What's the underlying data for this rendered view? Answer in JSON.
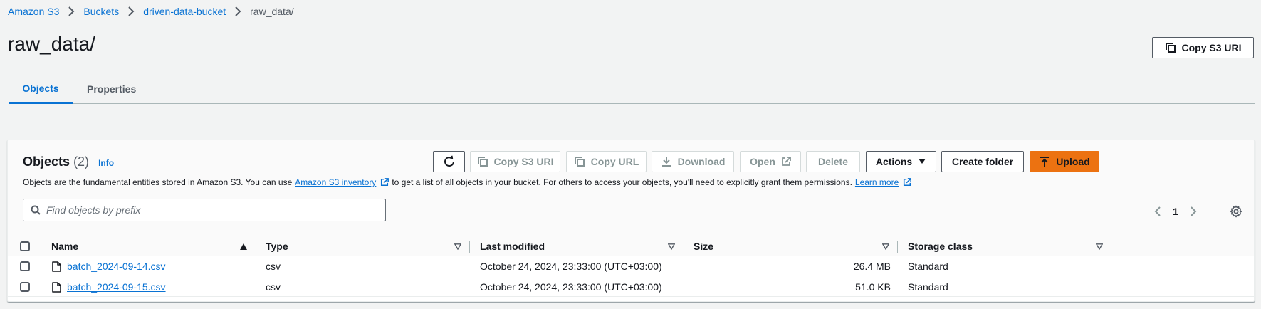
{
  "breadcrumb": {
    "items": [
      "Amazon S3",
      "Buckets",
      "driven-data-bucket"
    ],
    "current": "raw_data/"
  },
  "page": {
    "title": "raw_data/",
    "copy_uri_label": "Copy S3 URI"
  },
  "tabs": [
    "Objects",
    "Properties"
  ],
  "objects": {
    "heading": "Objects",
    "count": "(2)",
    "info": "Info",
    "description_prefix": "Objects are the fundamental entities stored in Amazon S3. You can use",
    "inventory_link": "Amazon S3 inventory",
    "description_mid": "to get a list of all objects in your bucket. For others to access your objects, you'll need to explicitly grant them permissions.",
    "learn_more": "Learn more",
    "toolbar": {
      "copy_s3_uri": "Copy S3 URI",
      "copy_url": "Copy URL",
      "download": "Download",
      "open": "Open",
      "delete": "Delete",
      "actions": "Actions",
      "create_folder": "Create folder",
      "upload": "Upload"
    },
    "search_placeholder": "Find objects by prefix",
    "page_number": "1",
    "columns": [
      "Name",
      "Type",
      "Last modified",
      "Size",
      "Storage class"
    ],
    "rows": [
      {
        "name": "batch_2024-09-14.csv",
        "type": "csv",
        "modified": "October 24, 2024, 23:33:00 (UTC+03:00)",
        "size": "26.4 MB",
        "storage": "Standard"
      },
      {
        "name": "batch_2024-09-15.csv",
        "type": "csv",
        "modified": "October 24, 2024, 23:33:00 (UTC+03:00)",
        "size": "51.0 KB",
        "storage": "Standard"
      }
    ]
  },
  "colors": {
    "link": "#0972d3",
    "primary": "#ec7211",
    "background": "#f2f3f3"
  }
}
